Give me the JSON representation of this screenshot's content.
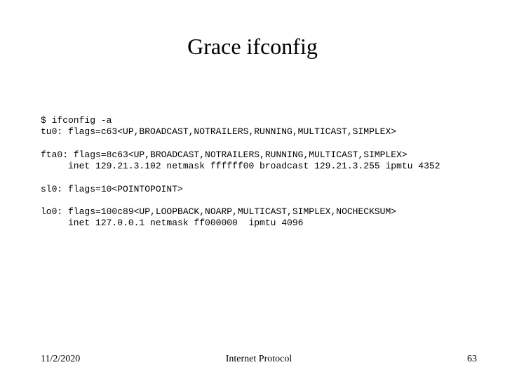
{
  "title": "Grace ifconfig",
  "code": {
    "line1": "$ ifconfig -a",
    "line2": "tu0: flags=c63<UP,BROADCAST,NOTRAILERS,RUNNING,MULTICAST,SIMPLEX>",
    "blank1": "",
    "line3": "fta0: flags=8c63<UP,BROADCAST,NOTRAILERS,RUNNING,MULTICAST,SIMPLEX>",
    "line4": "     inet 129.21.3.102 netmask ffffff00 broadcast 129.21.3.255 ipmtu 4352",
    "blank2": "",
    "line5": "sl0: flags=10<POINTOPOINT>",
    "blank3": "",
    "line6": "lo0: flags=100c89<UP,LOOPBACK,NOARP,MULTICAST,SIMPLEX,NOCHECKSUM>",
    "line7": "     inet 127.0.0.1 netmask ff000000  ipmtu 4096"
  },
  "footer": {
    "date": "11/2/2020",
    "title": "Internet Protocol",
    "page": "63"
  }
}
